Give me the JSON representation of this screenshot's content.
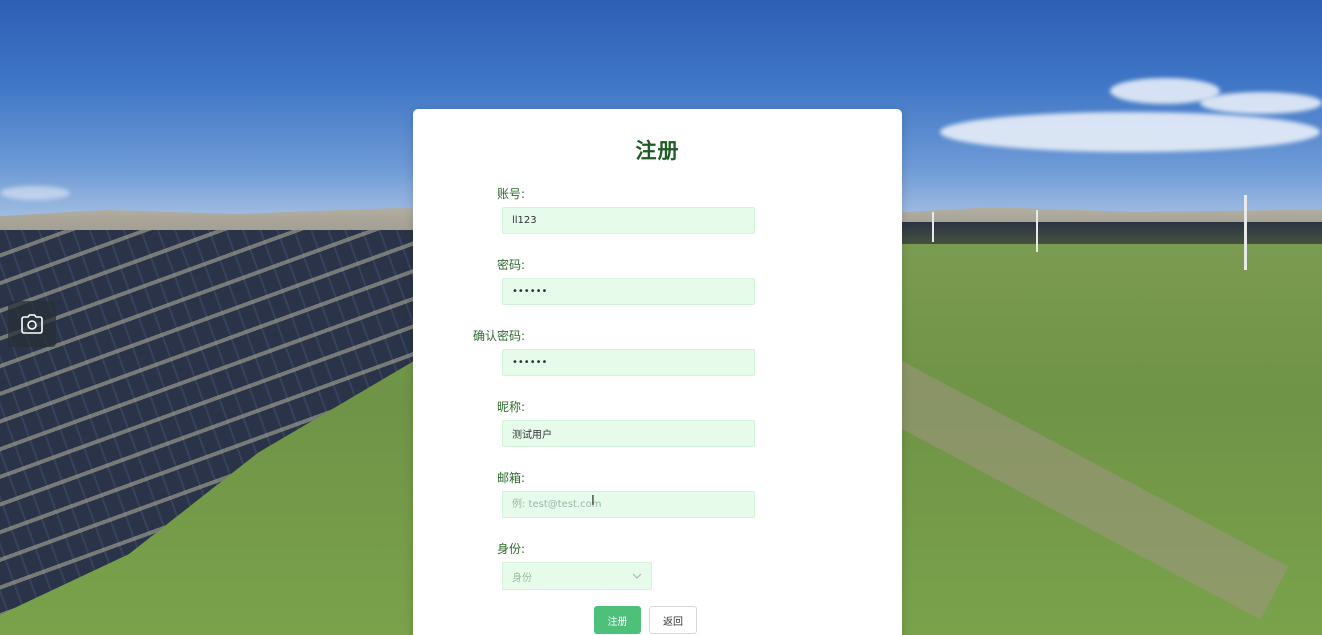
{
  "form": {
    "title": "注册",
    "fields": {
      "account": {
        "label": "账号:",
        "value": "ll123"
      },
      "password": {
        "label": "密码:",
        "value": "••••••"
      },
      "confirm_password": {
        "label": "确认密码:",
        "value": "••••••"
      },
      "nickname": {
        "label": "昵称:",
        "value": "测试用户"
      },
      "email": {
        "label": "邮箱:",
        "value": "",
        "placeholder": "例: test@test.com"
      },
      "role": {
        "label": "身份:",
        "placeholder": "身份"
      }
    },
    "buttons": {
      "register": "注册",
      "back": "返回"
    }
  },
  "icons": {
    "screenshot": "camera-icon",
    "select_arrow": "chevron-down-icon"
  },
  "colors": {
    "primary": "#4ec07a",
    "title": "#1f5b22",
    "input_bg": "#e6fbea",
    "label": "#2e6b2e"
  }
}
